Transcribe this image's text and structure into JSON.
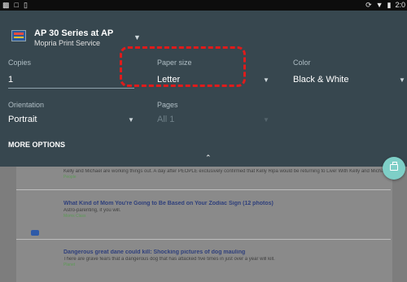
{
  "status_bar": {
    "left_icons": [
      "photo-icon",
      "notification-icon",
      "clipboard-icon"
    ],
    "right_icons": [
      "sync-icon",
      "wifi-icon",
      "battery-icon"
    ],
    "time": "2:0"
  },
  "print_dialog": {
    "printer_name": "AP 30 Series at AP",
    "printer_service": "Mopria Print Service",
    "copies": {
      "label": "Copies",
      "value": "1"
    },
    "paper_size": {
      "label": "Paper size",
      "value": "Letter"
    },
    "color": {
      "label": "Color",
      "value": "Black & White"
    },
    "orientation": {
      "label": "Orientation",
      "value": "Portrait"
    },
    "pages": {
      "label": "Pages",
      "value": "All 1"
    },
    "more_options": "MORE OPTIONS"
  },
  "background_feed": {
    "top_snippet": "Kelly and Michael are working things out. A day after PEOPLE exclusively confirmed that Kelly Ripa would be returning to Live! With Kelly and Michael after a nearly weeklong absence, a source says Michael Strahan is excited to have her",
    "top_source": "People",
    "articles": [
      {
        "title": "What Kind of Mom You're Going to Be Based on Your Zodiac Sign",
        "count": "(12 photos)",
        "body": "Astro-parenting, if you will.",
        "source": "Moms Class"
      },
      {
        "title": "Dangerous great dane could kill: Shocking pictures of dog mauling",
        "count": "",
        "body": "There are grave fears that a dangerous dog that has attacked five times in just over a year will kill.",
        "source": "Planet"
      }
    ]
  },
  "colors": {
    "panel": "#37474f",
    "highlight": "#e01b1b",
    "fab": "#7ecfc7"
  }
}
